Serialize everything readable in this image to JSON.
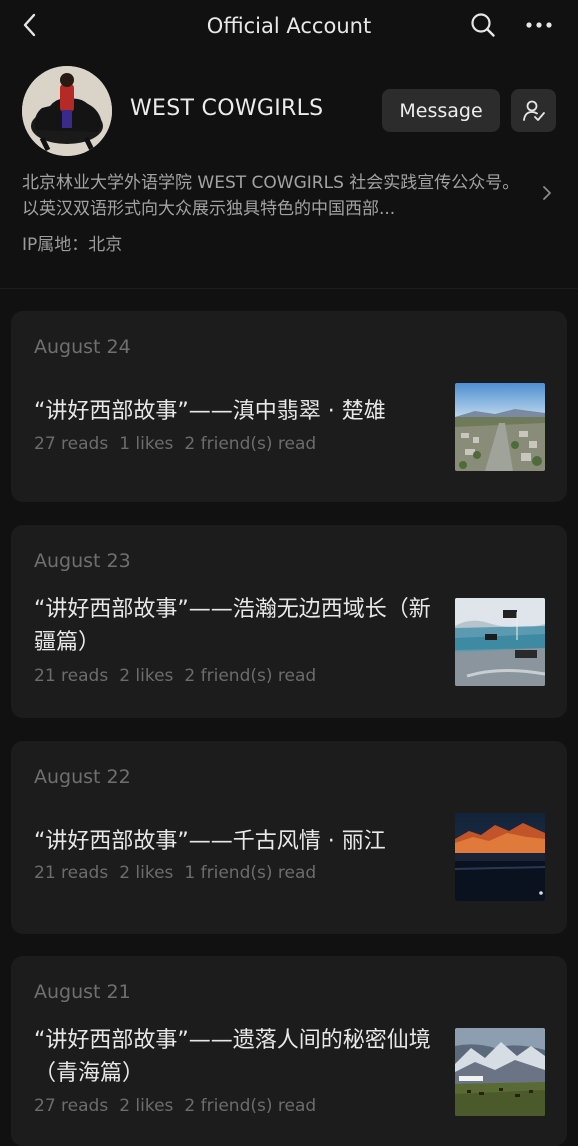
{
  "header": {
    "title": "Official Account",
    "back_icon": "chevron-left-icon",
    "search_icon": "search-icon",
    "more_icon": "more-horizontal-icon"
  },
  "profile": {
    "name": "WEST COWGIRLS",
    "message_label": "Message",
    "follow_icon": "user-check-icon",
    "description": "北京林业大学外语学院 WEST COWGIRLS 社会实践宣传公众号。以英汉双语形式向大众展示独具特色的中国西部...",
    "ip_label": "IP属地：北京"
  },
  "articles": [
    {
      "date": "August 24",
      "title": "“讲好西部故事”——滇中翡翠 · 楚雄",
      "reads": "27 reads",
      "likes": "1 likes",
      "friends": "2 friend(s) read"
    },
    {
      "date": "August 23",
      "title": "“讲好西部故事”——浩瀚无边西域长（新疆篇）",
      "reads": "21 reads",
      "likes": "2 likes",
      "friends": "2 friend(s) read"
    },
    {
      "date": "August 22",
      "title": "“讲好西部故事”——千古风情 · 丽江",
      "reads": "21 reads",
      "likes": "2 likes",
      "friends": "1 friend(s) read"
    },
    {
      "date": "August 21",
      "title": "“讲好西部故事”——遗落人间的秘密仙境 （青海篇）",
      "reads": "27 reads",
      "likes": "2 likes",
      "friends": "2 friend(s) read"
    }
  ],
  "colors": {
    "background": "#111111",
    "card": "#1c1c1c",
    "button": "#2c2c2c",
    "title_text": "#e8e8e8",
    "muted_text": "#6c6c6c"
  }
}
